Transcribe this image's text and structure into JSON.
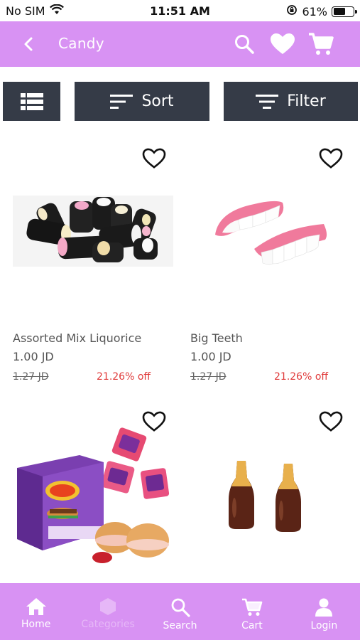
{
  "status_bar": {
    "carrier": "No SIM",
    "time": "11:51 AM",
    "battery_percent": "61%",
    "battery_level": 0.61
  },
  "header": {
    "title": "Candy"
  },
  "toolbar": {
    "sort_label": "Sort",
    "filter_label": "Filter"
  },
  "products": [
    {
      "name": "Assorted Mix Liquorice",
      "price": "1.00 JD",
      "old_price": "1.27 JD",
      "discount": "21.26% off"
    },
    {
      "name": "Big Teeth",
      "price": "1.00 JD",
      "old_price": "1.27 JD",
      "discount": "21.26% off"
    },
    {
      "name": "",
      "price": "",
      "old_price": "",
      "discount": ""
    },
    {
      "name": "",
      "price": "",
      "old_price": "",
      "discount": ""
    }
  ],
  "bottom_nav": {
    "items": [
      {
        "label": "Home",
        "icon": "home-icon"
      },
      {
        "label": "Categories",
        "icon": "categories-icon",
        "active": true
      },
      {
        "label": "Search",
        "icon": "search-icon"
      },
      {
        "label": "Cart",
        "icon": "cart-icon"
      },
      {
        "label": "Login",
        "icon": "user-icon"
      }
    ]
  },
  "colors": {
    "header": "#d892f3",
    "toolbar": "#353b47",
    "discount": "#e03a3a"
  }
}
